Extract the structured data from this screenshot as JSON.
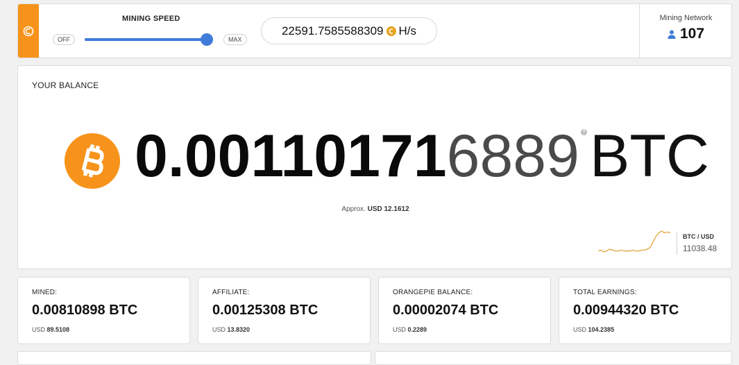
{
  "colors": {
    "brand_orange": "#f7931a",
    "slider_blue": "#3f7bd9",
    "sparkline": "#e0a43a"
  },
  "header": {
    "logo_icon": "orange-c-logo-icon",
    "speed_title": "MINING SPEED",
    "off_label": "OFF",
    "max_label": "MAX",
    "speed_level": 1.0,
    "hashrate_value": "22591.7585588309",
    "hashrate_unit": "H/s",
    "network_title": "Mining Network",
    "network_count": "107",
    "network_icon": "user-icon"
  },
  "balance": {
    "title": "YOUR BALANCE",
    "amount_bold": "0.00110171",
    "amount_light": "6889",
    "help_glyph": "?",
    "unit": "BTC",
    "approx_prefix": "Approx.",
    "approx_value": "USD 12.1612",
    "rate_pair": "BTC / USD",
    "rate_value": "11038.48",
    "sparkline": [
      11,
      11.5,
      10.5,
      11,
      12,
      11.5,
      11,
      11,
      11.5,
      11,
      11,
      11,
      11.5,
      11,
      11,
      11.5,
      11.5,
      12,
      13,
      16,
      19,
      21,
      22,
      21,
      21.5,
      21
    ]
  },
  "stats": [
    {
      "label": "MINED:",
      "value": "0.00810898 BTC",
      "usd_prefix": "USD",
      "usd_value": "89.5108"
    },
    {
      "label": "AFFILIATE:",
      "value": "0.00125308 BTC",
      "usd_prefix": "USD",
      "usd_value": "13.8320"
    },
    {
      "label": "ORANGEPIE BALANCE:",
      "value": "0.00002074 BTC",
      "usd_prefix": "USD",
      "usd_value": "0.2289"
    },
    {
      "label": "TOTAL EARNINGS:",
      "value": "0.00944320 BTC",
      "usd_prefix": "USD",
      "usd_value": "104.2385"
    }
  ]
}
